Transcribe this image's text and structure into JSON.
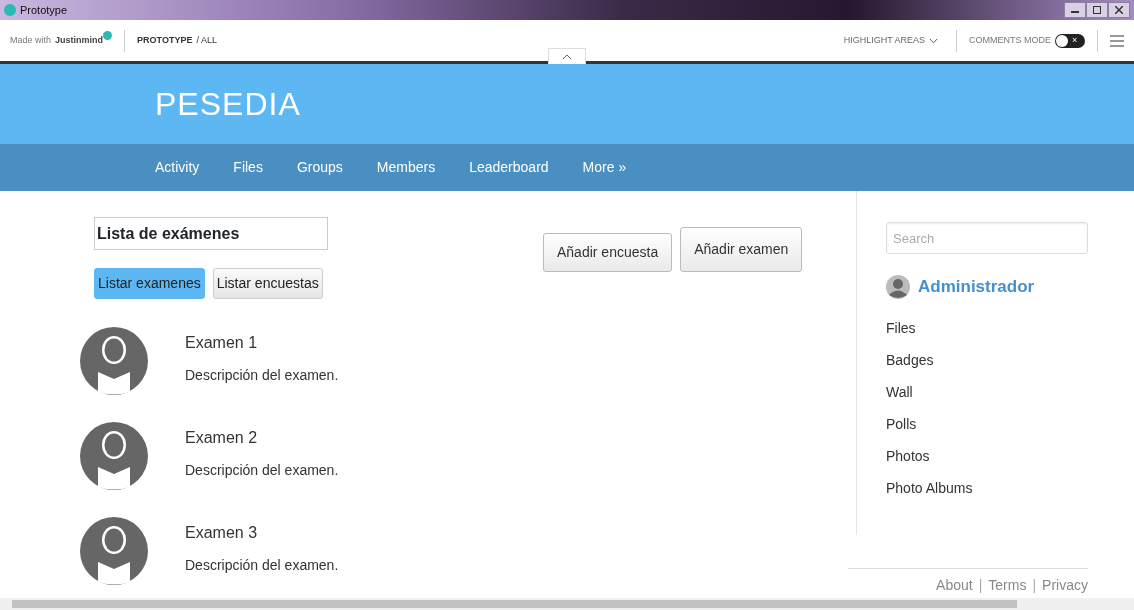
{
  "window": {
    "title": "Prototype"
  },
  "toolbar": {
    "made_with": "Made with",
    "brand": "Justinmind",
    "breadcrumb_main": "PROTOTYPE",
    "breadcrumb_sep": "/ ALL",
    "highlight": "HIGHLIGHT AREAS",
    "comments": "COMMENTS MODE",
    "comments_on": false,
    "toggle_mark": "×"
  },
  "site": {
    "title": "PESEDIA"
  },
  "nav": [
    {
      "label": "Activity"
    },
    {
      "label": "Files"
    },
    {
      "label": "Groups"
    },
    {
      "label": "Members"
    },
    {
      "label": "Leaderboard"
    },
    {
      "label": "More »"
    }
  ],
  "page_title": "Lista de exámenes",
  "actions": [
    {
      "label": "Añadir encuesta"
    },
    {
      "label": "Añadir examen"
    }
  ],
  "tabs": [
    {
      "label": "Listar examenes",
      "selected": true
    },
    {
      "label": "Listar encuestas",
      "selected": false
    }
  ],
  "items": [
    {
      "title": "Examen 1",
      "description": "Descripción del examen."
    },
    {
      "title": "Examen 2",
      "description": "Descripción del examen."
    },
    {
      "title": "Examen 3",
      "description": "Descripción del examen."
    }
  ],
  "sidebar": {
    "search": {
      "placeholder": "Search"
    },
    "user": "Administrador",
    "links": [
      {
        "label": "Files"
      },
      {
        "label": "Badges"
      },
      {
        "label": "Wall"
      },
      {
        "label": "Polls"
      },
      {
        "label": "Photos"
      },
      {
        "label": "Photo Albums"
      }
    ]
  },
  "footer": [
    {
      "label": "About"
    },
    {
      "label": "|",
      "kind": "separator"
    },
    {
      "label": "Terms"
    },
    {
      "label": "|",
      "kind": "separator"
    },
    {
      "label": "Privacy"
    }
  ]
}
